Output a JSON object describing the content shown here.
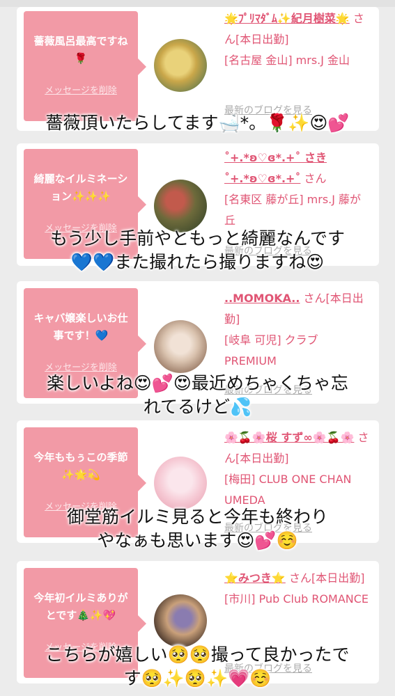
{
  "cards": [
    {
      "message": "薔薇風呂最高ですね🌹",
      "delete_label": "メッセージを削除",
      "name": "🌟ﾌﾟﾘﾏﾀﾞﾑ✨紀月樹菜🌟",
      "suffix": "さん[本日出勤]",
      "location": "[名古屋 金山] mrs.J 金山",
      "blog_label": "最新のブログを見る",
      "avatar_colors": [
        "#caa74a",
        "#e9d27a",
        "#6d7f4d"
      ]
    },
    {
      "message": "綺麗なイルミネーション✨✨✨",
      "delete_label": "メッセージを削除",
      "name": "˚+.*ʚ♡ɞ*.+˚ さき˚+.*ʚ♡ɞ*.+˚",
      "suffix": "さん",
      "location": "[名東区 藤が丘] mrs.J 藤が丘",
      "blog_label": "最新のブログを見る",
      "avatar_colors": [
        "#6d6a3b",
        "#c25a4c",
        "#3e4a2c"
      ]
    },
    {
      "message": "キャバ嬢楽しいお仕事です！💙",
      "delete_label": "メッセージを削除",
      "name": "..MOMOKA..",
      "suffix": "さん[本日出勤]",
      "location": "[岐阜 可児] クラブ PREMIUM",
      "blog_label": "最新のブログを見る",
      "avatar_colors": [
        "#d9c2ae",
        "#8c6a55",
        "#f1e2d6"
      ]
    },
    {
      "message": "今年ももぅこの季節✨🌟💫",
      "delete_label": "メッセージを削除",
      "name": "🌸🍒🌸桜 すず∞🌸🍒🌸",
      "suffix": "さん[本日出勤]",
      "location": "[梅田] CLUB ONE CHAN UMEDA",
      "blog_label": "最新のブログを見る",
      "avatar_colors": [
        "#f6c9d4",
        "#fbe6ec",
        "#e9a6b6"
      ]
    },
    {
      "message": "今年初イルミありがとです🎄✨💖",
      "delete_label": "メッセージを削除",
      "name": "⭐️みつき⭐️",
      "suffix": "さん[本日出勤]",
      "location": "[市川] Pub Club ROMANCE",
      "blog_label": "最新のブログを見る",
      "avatar_colors": [
        "#3a2a22",
        "#c9a07a",
        "#8a7cb0"
      ]
    }
  ],
  "captions": [
    [
      "薔薇頂いたらしてます🛁*。🌹✨😍💕"
    ],
    [
      "もう少し手前やともっと綺麗なんです",
      "💙💙また撮れたら撮りますね😍"
    ],
    [
      "楽しいよね😍💕😍最近めちゃくちゃ忘",
      "れてるけど💦"
    ],
    [
      "御堂筋イルミ見ると今年も終わり",
      "やなぁも思います😍💕☺️"
    ],
    [
      "こちらが嬉しい🥺🥺撮って良かったで",
      "す🥺✨🥺✨💗☺️"
    ]
  ]
}
